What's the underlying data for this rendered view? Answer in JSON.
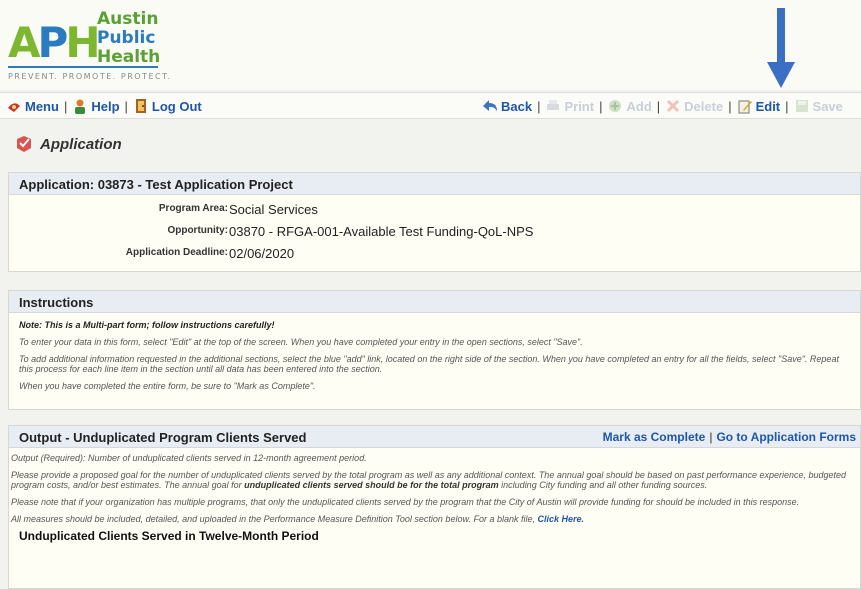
{
  "logo": {
    "letters": [
      "A",
      "P",
      "H"
    ],
    "words": [
      "Austin",
      "Public",
      "Health"
    ],
    "tagline": "PREVENT. PROMOTE. PROTECT."
  },
  "toolbar": {
    "left": [
      {
        "label": "Menu",
        "icon": "menu-icon"
      },
      {
        "label": "Help",
        "icon": "help-icon"
      },
      {
        "label": "Log Out",
        "icon": "logout-icon"
      }
    ],
    "right": [
      {
        "label": "Back",
        "icon": "back-arrow-icon",
        "enabled": true
      },
      {
        "label": "Print",
        "icon": "print-icon",
        "enabled": false
      },
      {
        "label": "Add",
        "icon": "add-icon",
        "enabled": false
      },
      {
        "label": "Delete",
        "icon": "delete-icon",
        "enabled": false
      },
      {
        "label": "Edit",
        "icon": "edit-icon",
        "enabled": true
      },
      {
        "label": "Save",
        "icon": "save-icon",
        "enabled": false
      }
    ]
  },
  "page_title": "Application",
  "application": {
    "header": "Application: 03873 - Test Application Project",
    "fields": [
      {
        "label": "Program Area:",
        "value": "Social Services"
      },
      {
        "label": "Opportunity:",
        "value": "03870 - RFGA-001-Available Test Funding-QoL-NPS"
      },
      {
        "label": "Application Deadline:",
        "value": "02/06/2020"
      }
    ]
  },
  "instructions": {
    "header": "Instructions",
    "note": "Note: This is a Multi-part form; follow instructions carefully!",
    "paragraphs": [
      "To enter your data in this form, select \"Edit\" at the top of the screen. When you have completed your entry in the open sections, select \"Save\".",
      "To add additional information requested in the additional sections, select the blue \"add\" link, located on the right side of the section. When you have completed an entry for all the fields, select \"Save\". Repeat this process for each line item in the section until all data has been entered into the section.",
      "When you have completed the entire form, be sure to \"Mark as Complete\"."
    ]
  },
  "output": {
    "header": "Output - Unduplicated Program Clients Served",
    "mark_complete": "Mark as Complete",
    "go_to_forms": "Go to Application Forms",
    "p1": "Output (Required): Number of unduplicated clients served in 12-month agreement period.",
    "p2a": "Please provide a proposed goal for the number of unduplicated clients served by the total program as well as any additional context. The annual goal should be based on past performance experience, budgeted program costs, and/or best estimates. The annual goal for ",
    "p2b": "unduplicated clients served should be for the total program",
    "p2c": " including City funding and all other funding sources.",
    "p3": "Please note that if your organization has multiple programs, that only the unduplicated clients served by the program that the City of Austin will provide funding for should be included in this response.",
    "p4a": "All measures should be included, detailed, and uploaded in the Performance Measure Definition Tool section below. For a blank file, ",
    "p4_link": "Click Here.",
    "subheader": "Unduplicated Clients Served in Twelve-Month Period"
  },
  "colors": {
    "link_blue": "#1e56a8",
    "arrow_blue": "#3a6fc4",
    "logo_green": "#7db72f",
    "logo_blue": "#2b7bbf",
    "section_header": "#e8edf3"
  }
}
